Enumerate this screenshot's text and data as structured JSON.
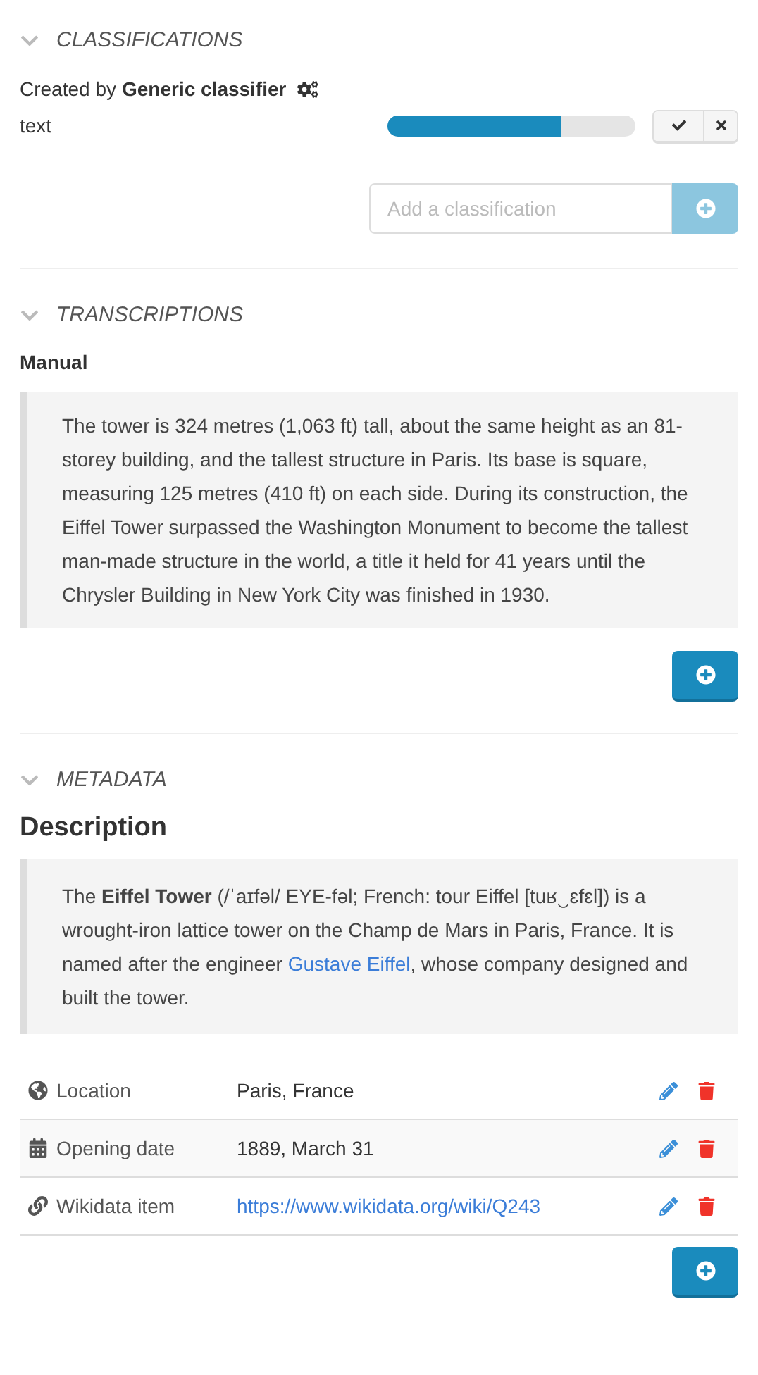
{
  "classifications": {
    "title": "CLASSIFICATIONS",
    "expanded": true,
    "created_by_prefix": "Created by",
    "created_by": "Generic classifier",
    "items": [
      {
        "label": "text",
        "level": 0.7
      }
    ],
    "add_field": {
      "placeholder": "Add a classification"
    }
  },
  "transcriptions": {
    "title": "TRANSCRIPTIONS",
    "expanded": true,
    "heading": "Manual",
    "text": "The tower is 324 metres (1,063 ft) tall, about the same height as an 81-storey building, and the tallest structure in Paris. Its base is square, measuring 125 metres (410 ft) on each side. During its construction, the Eiffel Tower surpassed the Washington Monument to become the tallest man-made structure in the world, a title it held for 41 years until the Chrysler Building in New York City was finished in 1930."
  },
  "metadata": {
    "title": "METADATA",
    "expanded": true,
    "heading": "Description",
    "description": {
      "before": "The **Eiffel Tower** (/ˈaɪfəl/ EYE-fəl; French: tour Eiffel [tuʁ‿ɛfɛl]) is a wrought-iron lattice tower on the Champ de Mars in Paris, France. It is named after the engineer",
      "link": "Gustave Eiffel",
      "after": ", whose company designed and built the tower."
    },
    "rows": [
      {
        "kind": "location",
        "name": "Location",
        "value": "Paris, France"
      },
      {
        "kind": "date",
        "name": "Opening date",
        "value": "1889, March 31"
      },
      {
        "kind": "url",
        "name": "Wikidata item",
        "value": "https://www.wikidata.org/wiki/Q243"
      }
    ]
  }
}
